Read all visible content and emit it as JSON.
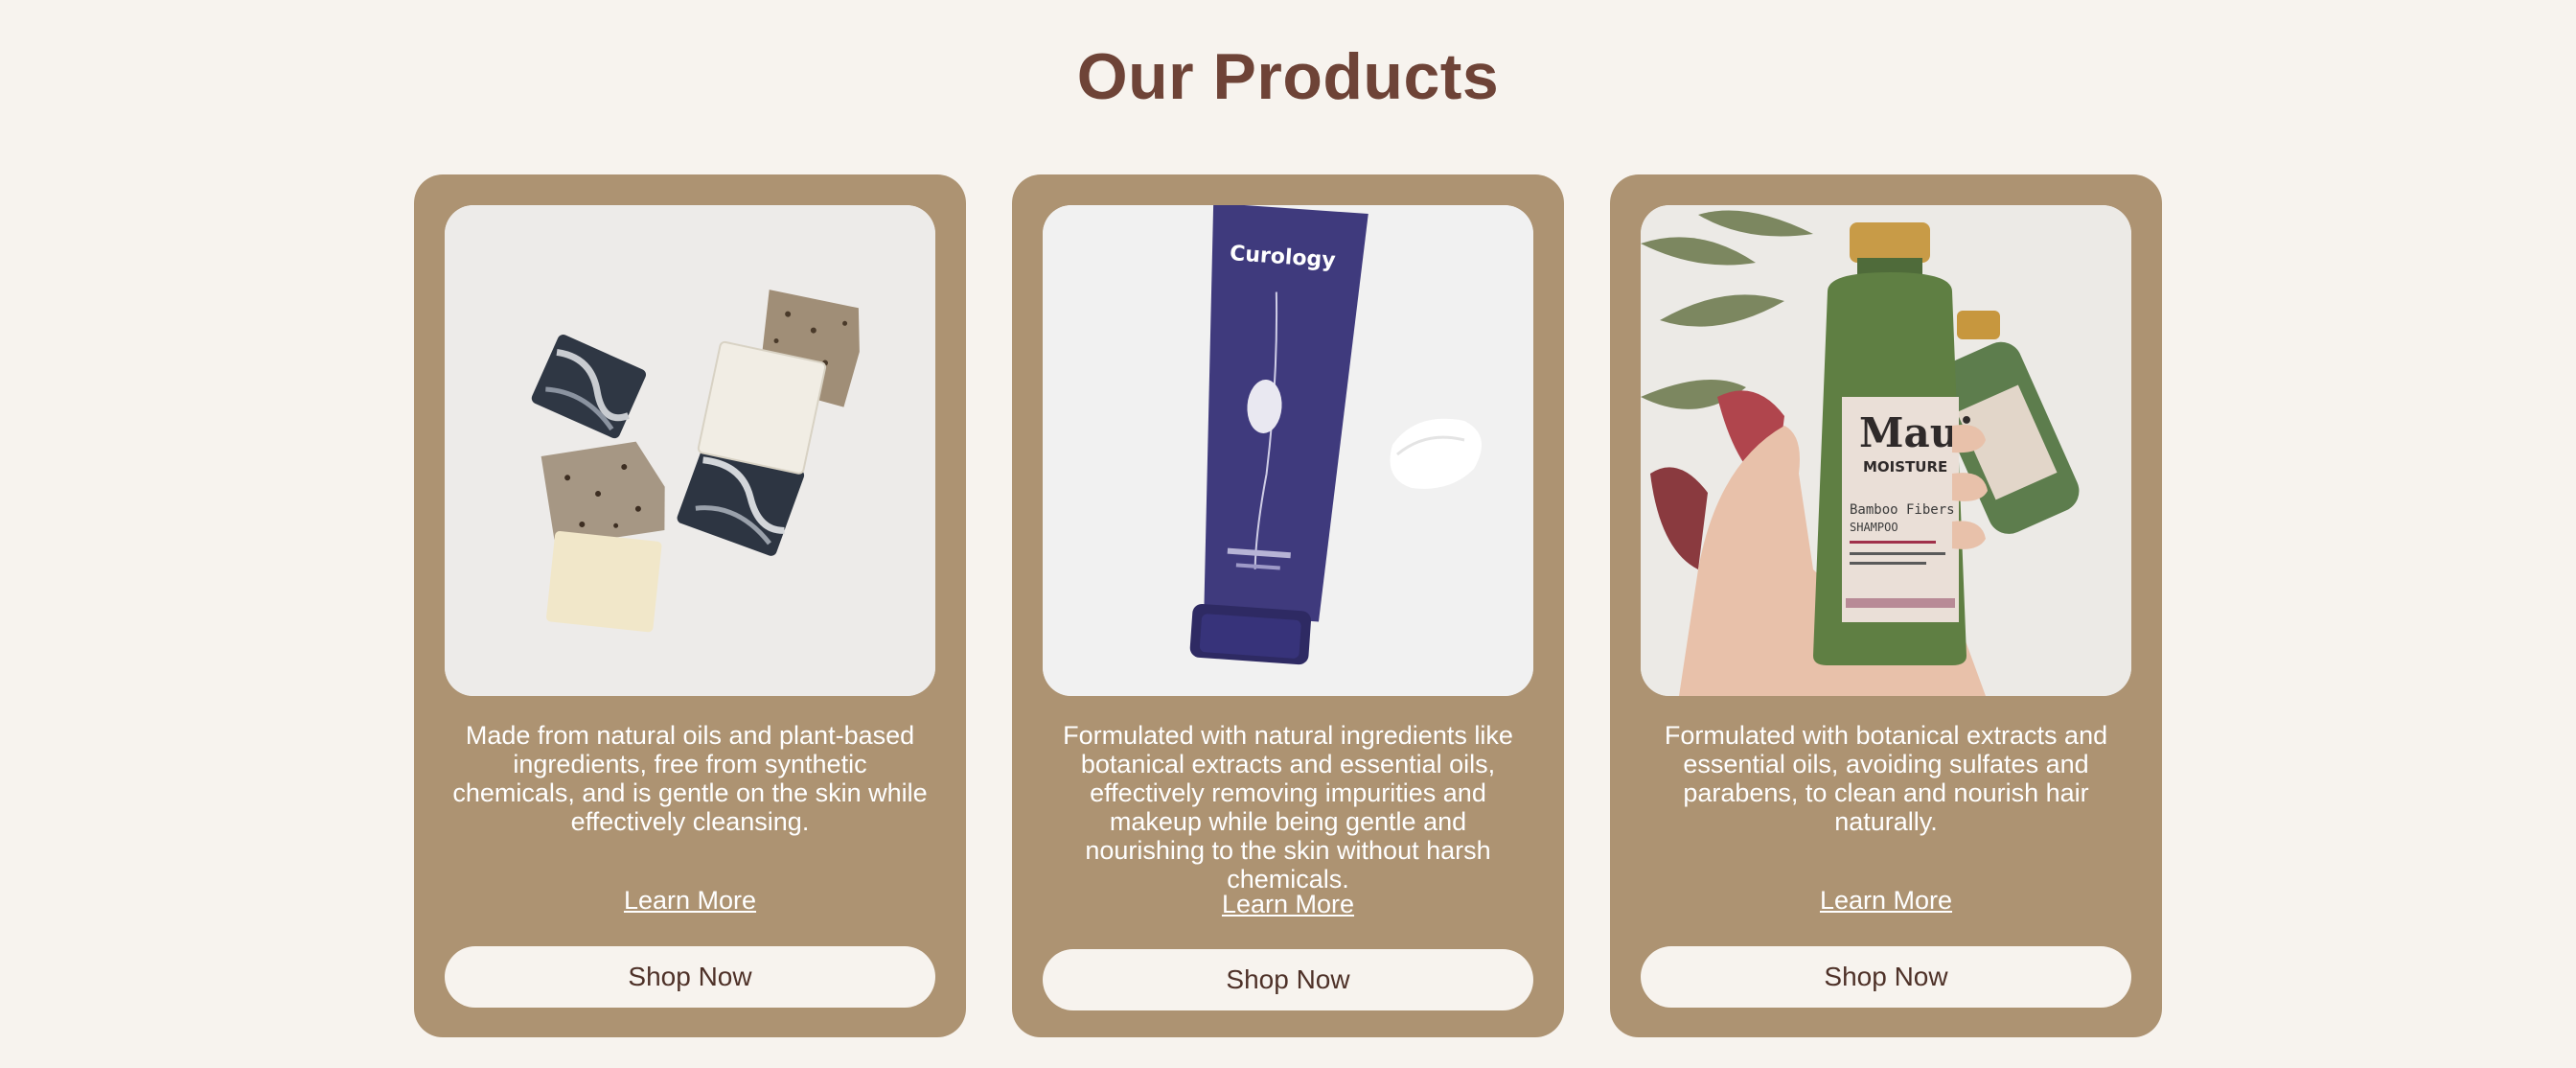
{
  "page": {
    "title": "Our Products"
  },
  "products": [
    {
      "image_alt": "Natural soap bars",
      "description": "Made from natural oils and plant-based ingredients, free from synthetic chemicals, and is gentle on the skin while effectively cleansing.",
      "learn_more_label": "Learn More",
      "shop_now_label": "Shop Now"
    },
    {
      "image_alt": "Curology cleanser tube",
      "brand_text": "Curology",
      "description": "Formulated with natural ingredients like botanical extracts and essential oils, effectively removing impurities and makeup while being gentle and nourishing to the skin without harsh chemicals.",
      "learn_more_label": "Learn More",
      "shop_now_label": "Shop Now"
    },
    {
      "image_alt": "Maui Moisture shampoo bottle",
      "brand_text": "Maui",
      "brand_sub": "MOISTURE",
      "product_line": "Bamboo Fibers",
      "product_type": "SHAMPOO",
      "description": "Formulated with botanical extracts and essential oils, avoiding sulfates and parabens, to clean and nourish hair naturally.",
      "learn_more_label": "Learn More",
      "shop_now_label": "Shop Now"
    }
  ],
  "colors": {
    "background": "#f7f3ee",
    "card": "#ad9372",
    "title": "#6e4337",
    "button_text": "#4e3128"
  }
}
